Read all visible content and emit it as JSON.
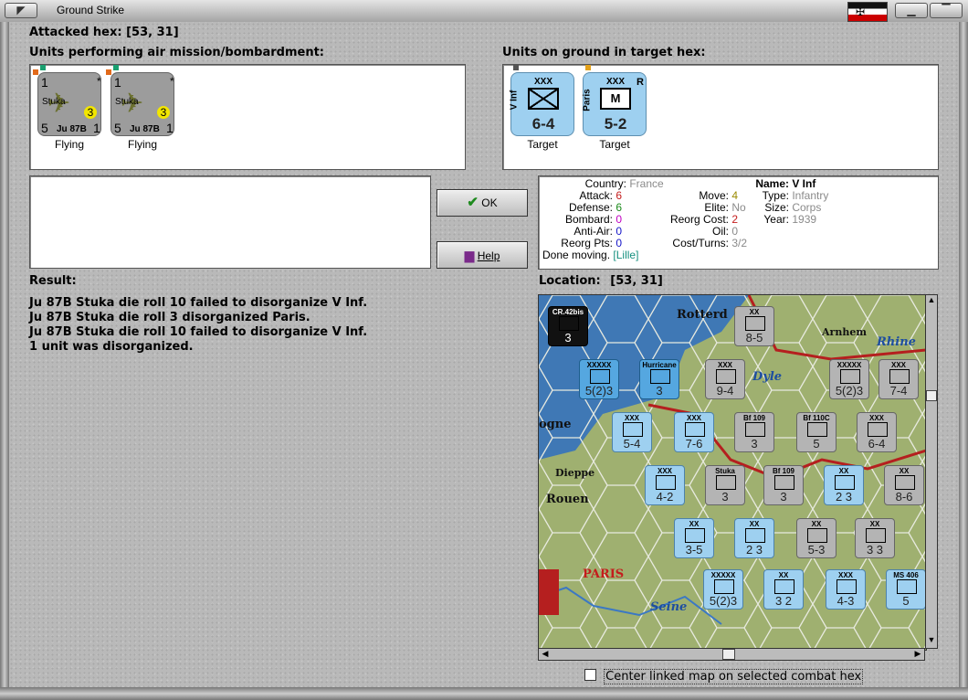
{
  "window": {
    "title": "Ground Strike"
  },
  "attacked": {
    "label": "Attacked hex:",
    "coords": "[53, 31]"
  },
  "air_panel": {
    "label": "Units performing air mission/bombardment:",
    "units": [
      {
        "top_left": "1",
        "star": "*",
        "name": "Stuka",
        "badge": "3",
        "model": "Ju 87B",
        "bl": "5",
        "br": "1",
        "status": "Flying"
      },
      {
        "top_left": "1",
        "star": "*",
        "name": "Stuka",
        "badge": "3",
        "model": "Ju 87B",
        "bl": "5",
        "br": "1",
        "status": "Flying"
      }
    ]
  },
  "ground_panel": {
    "label": "Units on ground in target hex:",
    "units": [
      {
        "size": "XXX",
        "side": "V Inf",
        "strength": "6-4",
        "letter": "",
        "extra": "",
        "caption": "Target"
      },
      {
        "size": "XXX",
        "side": "Paris",
        "strength": "5-2",
        "letter": "M",
        "extra": "R",
        "caption": "Target"
      }
    ]
  },
  "buttons": {
    "ok": "OK",
    "help": "Help"
  },
  "unit_info": {
    "country_k": "Country:",
    "country_v": "France",
    "attack_k": "Attack:",
    "attack_v": "6",
    "defense_k": "Defense:",
    "defense_v": "6",
    "bombard_k": "Bombard:",
    "bombard_v": "0",
    "antiair_k": "Anti-Air:",
    "antiair_v": "0",
    "reorgpts_k": "Reorg Pts:",
    "reorgpts_v": "0",
    "move_k": "Move:",
    "move_v": "4",
    "elite_k": "Elite:",
    "elite_v": "No",
    "reorgcost_k": "Reorg Cost:",
    "reorgcost_v": "2",
    "oil_k": "Oil:",
    "oil_v": "0",
    "costturns_k": "Cost/Turns:",
    "costturns_v": "3/2",
    "name_k": "Name:",
    "name_v": "V Inf",
    "type_k": "Type:",
    "type_v": "Infantry",
    "size_k": "Size:",
    "size_v": "Corps",
    "year_k": "Year:",
    "year_v": "1939",
    "done_text": "Done moving.",
    "done_loc": "[Lille]"
  },
  "result": {
    "label": "Result:",
    "lines": [
      "Ju 87B Stuka die roll 10 failed to disorganize V Inf.",
      "Ju 87B Stuka die roll 3 disorganized Paris.",
      "Ju 87B Stuka die roll 10 failed to disorganize V Inf.",
      "1 unit was disorganized."
    ]
  },
  "location": {
    "label": "Location:",
    "coords": "[53, 31]"
  },
  "map": {
    "places": [
      "Rotterd",
      "Arnhem",
      "Rhine",
      "Dyle",
      "Dieppe",
      "Rouen",
      "PARIS",
      "Seine",
      "ogne"
    ],
    "counters": [
      {
        "top": "XX",
        "value": "8-5"
      },
      {
        "top": "XXXXX",
        "value": "5(2)3"
      },
      {
        "top": "Hurricane",
        "value": "3"
      },
      {
        "top": "XXX",
        "value": "9-4"
      },
      {
        "top": "XXXXX",
        "value": "5(2)3"
      },
      {
        "top": "XXX",
        "value": "7-4"
      },
      {
        "top": "XXX",
        "value": "5-4"
      },
      {
        "top": "XXX",
        "value": "7-6"
      },
      {
        "top": "Bf 109",
        "value": "3"
      },
      {
        "top": "Bf 110C",
        "value": "5"
      },
      {
        "top": "XXX",
        "value": "6-4"
      },
      {
        "top": "XXX",
        "value": "4-2"
      },
      {
        "top": "Stuka",
        "value": "3"
      },
      {
        "top": "Bf 109",
        "value": "3"
      },
      {
        "top": "XX",
        "value": "2 3"
      },
      {
        "top": "XX",
        "value": "8-6"
      },
      {
        "top": "XX",
        "value": "3-5"
      },
      {
        "top": "XX",
        "value": "2 3"
      },
      {
        "top": "XX",
        "value": "5-3"
      },
      {
        "top": "XX",
        "value": "3 3"
      },
      {
        "top": "XXXXX",
        "value": "5(2)3"
      },
      {
        "top": "XX",
        "value": "3 2"
      },
      {
        "top": "XXX",
        "value": "4-3"
      },
      {
        "top": "MS 406",
        "value": "5"
      },
      {
        "top": "CR.42bis",
        "value": "3"
      }
    ]
  },
  "checkbox": {
    "label": "Center linked map on selected combat hex"
  }
}
